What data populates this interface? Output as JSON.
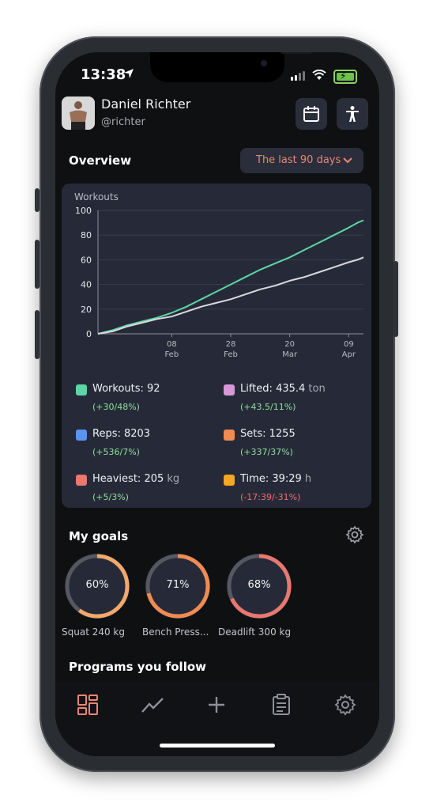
{
  "status": {
    "time": "13:38"
  },
  "user": {
    "name": "Daniel Richter",
    "handle": "@richter"
  },
  "overview": {
    "title": "Overview",
    "range_label": "The last 90 days"
  },
  "chart_data": {
    "type": "line",
    "title": "Workouts",
    "xlabel": "",
    "ylabel": "",
    "ylim": [
      0,
      100
    ],
    "yticks": [
      0,
      20,
      40,
      60,
      80,
      100
    ],
    "xticks": [
      {
        "day": 0,
        "label": "",
        "sub": ""
      },
      {
        "day": 25,
        "label": "08",
        "sub": "Feb"
      },
      {
        "day": 45,
        "label": "28",
        "sub": "Feb"
      },
      {
        "day": 65,
        "label": "20",
        "sub": "Mar"
      },
      {
        "day": 85,
        "label": "09",
        "sub": "Apr"
      }
    ],
    "xlim": [
      0,
      90
    ],
    "grid": true,
    "series": [
      {
        "name": "Workouts",
        "color": "#5cd6a4",
        "x": [
          0,
          5,
          10,
          15,
          20,
          25,
          30,
          35,
          40,
          45,
          50,
          55,
          60,
          65,
          70,
          75,
          80,
          85,
          88,
          90
        ],
        "y": [
          0,
          3,
          7,
          10,
          13,
          17,
          22,
          28,
          34,
          40,
          46,
          52,
          57,
          62,
          68,
          74,
          80,
          86,
          90,
          92
        ]
      },
      {
        "series_color_note": "",
        "color": "#d9d9de",
        "x": [
          0,
          5,
          10,
          15,
          20,
          25,
          30,
          35,
          40,
          45,
          50,
          55,
          60,
          65,
          70,
          75,
          80,
          85,
          88,
          90
        ],
        "y": [
          0,
          2,
          6,
          9,
          12,
          14,
          18,
          22,
          25,
          28,
          32,
          36,
          39,
          43,
          46,
          50,
          54,
          58,
          60,
          62
        ]
      }
    ]
  },
  "stats": [
    {
      "label": "Workouts: ",
      "value": "92",
      "unit": "",
      "delta": "(+30/48%)",
      "delta_sign": "pos",
      "color": "#5cd6a4"
    },
    {
      "label": "Lifted: ",
      "value": "435.4",
      "unit": " ton",
      "delta": "(+43.5/11%)",
      "delta_sign": "pos",
      "color": "#d897d8"
    },
    {
      "label": "Reps: ",
      "value": "8203",
      "unit": "",
      "delta": "(+536/7%)",
      "delta_sign": "pos",
      "color": "#5b93f0"
    },
    {
      "label": "Sets: ",
      "value": "1255",
      "unit": "",
      "delta": "(+337/37%)",
      "delta_sign": "pos",
      "color": "#f08b52"
    },
    {
      "label": "Heaviest: ",
      "value": "205",
      "unit": " kg",
      "delta": "(+5/3%)",
      "delta_sign": "pos",
      "color": "#e9786f"
    },
    {
      "label": "Time: ",
      "value": "39:29",
      "unit": " h",
      "delta": "(-17:39/-31%)",
      "delta_sign": "neg",
      "color": "#f5a623"
    }
  ],
  "goals": {
    "title": "My goals",
    "items": [
      {
        "percent_label": "60%",
        "progress": 0.6,
        "label": "Squat 240 kg",
        "color": "#f3a86a"
      },
      {
        "percent_label": "71%",
        "progress": 0.71,
        "label": "Bench Press...",
        "color": "#f08b52"
      },
      {
        "percent_label": "68%",
        "progress": 0.68,
        "label": "Deadlift 300 kg",
        "color": "#e9786f"
      }
    ]
  },
  "programs": {
    "title": "Programs you follow"
  },
  "icons": {
    "calendar": "calendar-icon",
    "accessibility": "accessibility-icon",
    "chevron": "chevron-down-icon",
    "settings": "gear-icon",
    "tabs": [
      "dashboard-icon",
      "trend-icon",
      "plus-icon",
      "clipboard-icon",
      "gear-icon"
    ]
  },
  "colors": {
    "accent": "#e98676",
    "card": "#262a38",
    "background": "#0f1012"
  }
}
